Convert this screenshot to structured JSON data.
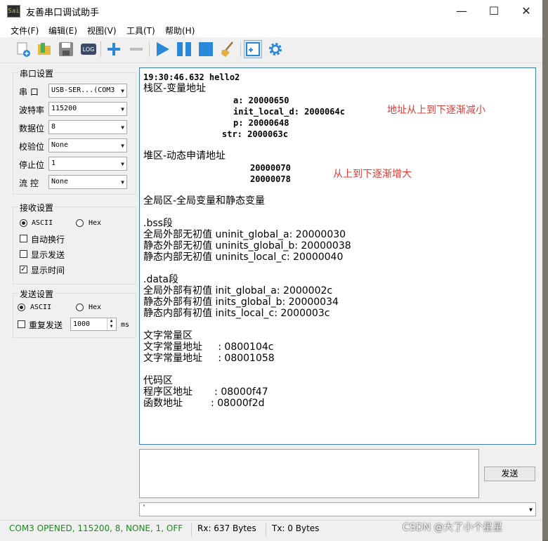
{
  "window": {
    "title": "友善串口调试助手",
    "icon_text": "Sai"
  },
  "menu": [
    "文件(F)",
    "编辑(E)",
    "视图(V)",
    "工具(T)",
    "帮助(H)"
  ],
  "toolbar": {
    "icons": [
      "new-file-icon",
      "open-icon",
      "save-icon",
      "log-icon",
      "add-icon",
      "remove-icon",
      "play-icon",
      "pause-icon",
      "stop-icon",
      "clear-icon",
      "add-window-icon",
      "settings-icon"
    ],
    "log_label": "LOG"
  },
  "serial": {
    "title": "串口设置",
    "port_label": "串 口",
    "port_value": "USB-SER...(COM3",
    "baud_label": "波特率",
    "baud_value": "115200",
    "databits_label": "数据位",
    "databits_value": "8",
    "parity_label": "校验位",
    "parity_value": "None",
    "stopbits_label": "停止位",
    "stopbits_value": "1",
    "flow_label": "流 控",
    "flow_value": "None"
  },
  "receive": {
    "title": "接收设置",
    "ascii": "ASCII",
    "hex": "Hex",
    "auto_wrap": "自动换行",
    "show_send": "显示发送",
    "show_time": "显示时间",
    "show_time_checked": true
  },
  "send": {
    "title": "发送设置",
    "ascii": "ASCII",
    "hex": "Hex",
    "repeat": "重复发送",
    "interval": "1000",
    "unit": "ms",
    "button": "发送",
    "combo_value": "'"
  },
  "output": {
    "lines": [
      "19:30:46.632 hello2",
      "栈区-变量地址",
      "a: 20000650",
      "init_local_d: 2000064c",
      "p: 20000648",
      "str: 2000063c",
      "堆区-动态申请地址",
      "20000070",
      "20000078",
      "全局区-全局变量和静态变量",
      ".bss段",
      "全局外部无初值 uninit_global_a: 20000030",
      "静态外部无初值 uninits_global_b: 20000038",
      "静态内部无初值 uninits_local_c: 20000040",
      ".data段",
      "全局外部有初值 init_global_a: 2000002c",
      "静态外部有初值 inits_global_b: 20000034",
      "静态内部有初值 inits_local_c: 2000003c",
      "文字常量区",
      "文字常量地址     : 0800104c",
      "文字常量地址     : 08001058",
      "代码区",
      "程序区地址       : 08000f47",
      "函数地址         : 08000f2d"
    ],
    "note1": "地址从上到下逐渐减小",
    "note2": "从上到下逐渐增大"
  },
  "status": {
    "port_state": "COM3 OPENED, 115200, 8, NONE, 1, OFF",
    "rx": "Rx: 637 Bytes",
    "tx": "Tx: 0 Bytes",
    "state_color": "#1a8a1a"
  },
  "watermark": "CSDN @大了小个星星"
}
